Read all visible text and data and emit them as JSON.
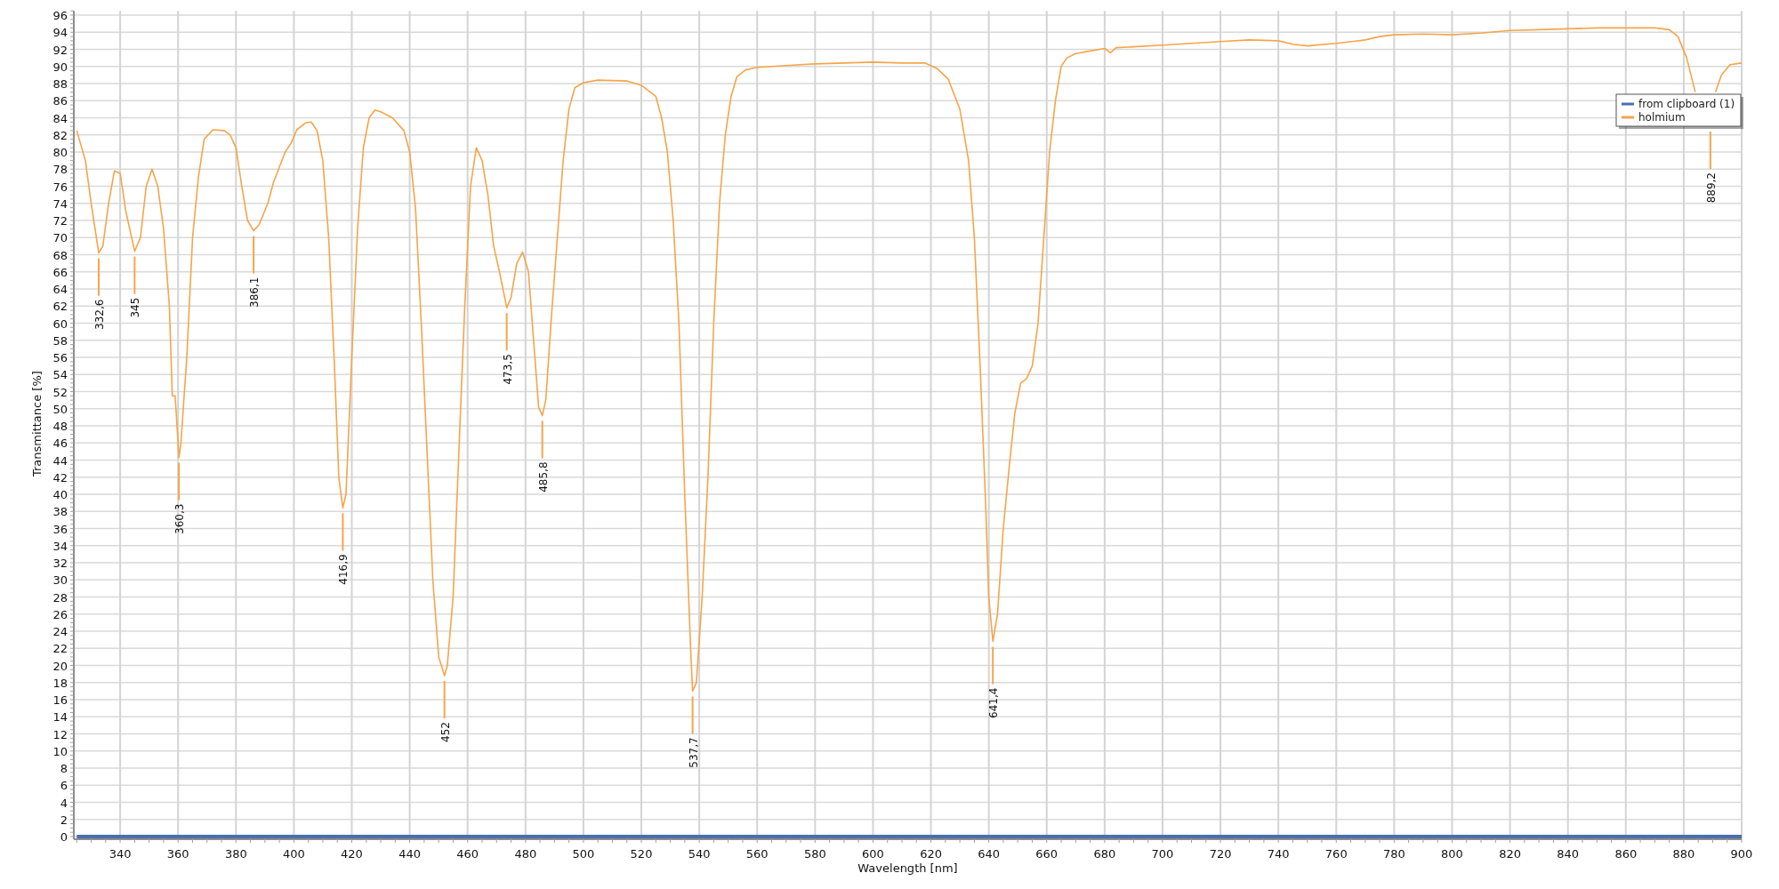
{
  "chart": {
    "chart_data": {
      "type": "line",
      "xlabel": "Wavelength [nm]",
      "ylabel": "Transmittance [%]",
      "xlim": [
        324,
        900
      ],
      "ylim": [
        0,
        96.5
      ],
      "grid": true,
      "legend": true,
      "xticks": [
        340,
        360,
        380,
        400,
        420,
        440,
        460,
        480,
        500,
        520,
        540,
        560,
        580,
        600,
        620,
        640,
        660,
        680,
        700,
        720,
        740,
        760,
        780,
        800,
        820,
        840,
        860,
        880,
        900
      ],
      "yticks": [
        0,
        2,
        4,
        6,
        8,
        10,
        12,
        14,
        16,
        18,
        20,
        22,
        24,
        26,
        28,
        30,
        32,
        34,
        36,
        38,
        40,
        42,
        44,
        46,
        48,
        50,
        52,
        54,
        56,
        58,
        60,
        62,
        64,
        66,
        68,
        70,
        72,
        74,
        76,
        78,
        80,
        82,
        84,
        86,
        88,
        90,
        92,
        94,
        96
      ],
      "x": [
        325,
        328,
        330,
        332.6,
        334,
        336,
        338,
        340,
        342,
        345,
        347,
        349,
        351,
        353,
        355,
        357,
        358,
        359,
        360.3,
        361,
        363,
        365,
        367,
        369,
        372,
        376,
        378,
        380,
        382,
        384,
        386.1,
        388,
        391,
        393,
        397,
        399,
        401,
        404,
        406,
        408,
        410,
        412,
        414,
        415.5,
        416.9,
        418,
        420,
        422,
        424,
        426,
        428,
        430,
        434,
        438,
        440,
        442,
        444,
        446,
        448,
        450,
        452,
        453,
        455,
        457,
        459,
        461,
        463,
        465,
        467,
        469,
        471,
        473.5,
        475,
        477,
        479,
        481,
        483,
        484.5,
        485.8,
        487,
        489,
        491,
        493,
        495,
        497,
        500,
        505,
        515,
        520,
        525,
        527,
        529,
        531,
        533,
        535,
        537,
        537.7,
        539,
        541,
        543,
        545,
        547,
        549,
        551,
        553,
        556,
        560,
        570,
        580,
        590,
        600,
        610,
        618,
        622,
        626,
        630,
        633,
        635,
        637,
        639,
        640,
        641.4,
        643,
        645,
        647,
        649,
        651,
        653,
        655,
        657,
        659,
        661,
        663,
        665,
        667,
        670,
        675,
        680,
        682,
        684,
        690,
        700,
        710,
        720,
        730,
        740,
        745,
        750,
        760,
        770,
        775,
        780,
        790,
        800,
        810,
        820,
        830,
        840,
        850,
        860,
        870,
        875,
        878,
        881,
        884,
        887,
        889.2,
        891,
        893,
        896,
        900
      ],
      "series": [
        {
          "name": "from clipboard (1)",
          "color": "#4a6eaf",
          "values": [
            0,
            0,
            0,
            0,
            0,
            0,
            0,
            0,
            0,
            0,
            0,
            0,
            0,
            0,
            0,
            0,
            0,
            0,
            0,
            0,
            0,
            0,
            0,
            0,
            0,
            0,
            0,
            0,
            0,
            0,
            0,
            0,
            0,
            0,
            0,
            0,
            0,
            0,
            0,
            0,
            0,
            0,
            0,
            0,
            0,
            0,
            0,
            0,
            0,
            0,
            0,
            0,
            0,
            0,
            0,
            0,
            0,
            0,
            0,
            0,
            0,
            0,
            0,
            0,
            0,
            0,
            0,
            0,
            0,
            0,
            0,
            0,
            0,
            0,
            0,
            0,
            0,
            0,
            0,
            0,
            0,
            0,
            0,
            0,
            0,
            0,
            0,
            0,
            0,
            0,
            0,
            0,
            0,
            0,
            0,
            0,
            0,
            0,
            0,
            0,
            0,
            0,
            0,
            0,
            0,
            0,
            0,
            0,
            0,
            0,
            0,
            0,
            0,
            0,
            0,
            0,
            0,
            0,
            0,
            0,
            0,
            0,
            0,
            0,
            0,
            0,
            0,
            0,
            0,
            0,
            0,
            0,
            0,
            0,
            0,
            0,
            0,
            0,
            0,
            0,
            0,
            0,
            0,
            0,
            0,
            0,
            0,
            0,
            0,
            0,
            0,
            0,
            0,
            0,
            0,
            0,
            0,
            0,
            0,
            0,
            0,
            0,
            0,
            0,
            0,
            0,
            0,
            0,
            0,
            0,
            0
          ]
        },
        {
          "name": "holmium",
          "color": "#f5a54a",
          "values": [
            82.5,
            79,
            74,
            68.2,
            69,
            74,
            77.8,
            77.5,
            73,
            68.4,
            70,
            76,
            78,
            76,
            71,
            62,
            51.5,
            51.5,
            44.3,
            46,
            56,
            70,
            77,
            81.5,
            82.6,
            82.5,
            82,
            80.5,
            76,
            72,
            70.8,
            71.5,
            74,
            76.5,
            80,
            81,
            82.6,
            83.4,
            83.5,
            82.5,
            79,
            70,
            55,
            42,
            38.4,
            40,
            56,
            71,
            80.5,
            84,
            84.9,
            84.7,
            84,
            82.5,
            80,
            73.5,
            60,
            45,
            30,
            21,
            18.8,
            20,
            28,
            45,
            62,
            76,
            80.5,
            79,
            75,
            69,
            66,
            61.8,
            63,
            67,
            68.3,
            66,
            57,
            50.2,
            49.2,
            51,
            61,
            70,
            79,
            85,
            87.5,
            88.1,
            88.4,
            88.3,
            87.8,
            86.5,
            84,
            80,
            72,
            60,
            40,
            22,
            17,
            18,
            28,
            42,
            60,
            74,
            82,
            86.5,
            88.8,
            89.6,
            89.9,
            90.1,
            90.3,
            90.4,
            90.5,
            90.4,
            90.4,
            89.8,
            88.5,
            85,
            79,
            70,
            55,
            38,
            28,
            22.8,
            26,
            36,
            43,
            49.5,
            53,
            53.5,
            55,
            60,
            70,
            80,
            86,
            90,
            91,
            91.5,
            91.8,
            92.1,
            91.6,
            92.2,
            92.3,
            92.5,
            92.7,
            92.9,
            93.1,
            93,
            92.6,
            92.4,
            92.7,
            93.1,
            93.5,
            93.7,
            93.8,
            93.7,
            93.9,
            94.2,
            94.3,
            94.4,
            94.5,
            94.5,
            94.5,
            94.3,
            93.5,
            91,
            87,
            null,
            null,
            87,
            89,
            90.2,
            90.4
          ]
        }
      ],
      "annotations": [
        {
          "x": 332.6,
          "y": 68.2,
          "text": "332,6"
        },
        {
          "x": 345,
          "y": 68.4,
          "text": "345"
        },
        {
          "x": 360.3,
          "y": 44.3,
          "text": "360,3"
        },
        {
          "x": 386.1,
          "y": 70.8,
          "text": "386,1"
        },
        {
          "x": 416.9,
          "y": 38.4,
          "text": "416,9"
        },
        {
          "x": 452,
          "y": 18.8,
          "text": "452"
        },
        {
          "x": 473.5,
          "y": 61.8,
          "text": "473,5"
        },
        {
          "x": 485.8,
          "y": 49.2,
          "text": "485,8"
        },
        {
          "x": 537.7,
          "y": 17,
          "text": "537,7"
        },
        {
          "x": 641.4,
          "y": 22.8,
          "text": "641,4"
        },
        {
          "x": 889.2,
          "text": "889,2"
        }
      ]
    }
  }
}
